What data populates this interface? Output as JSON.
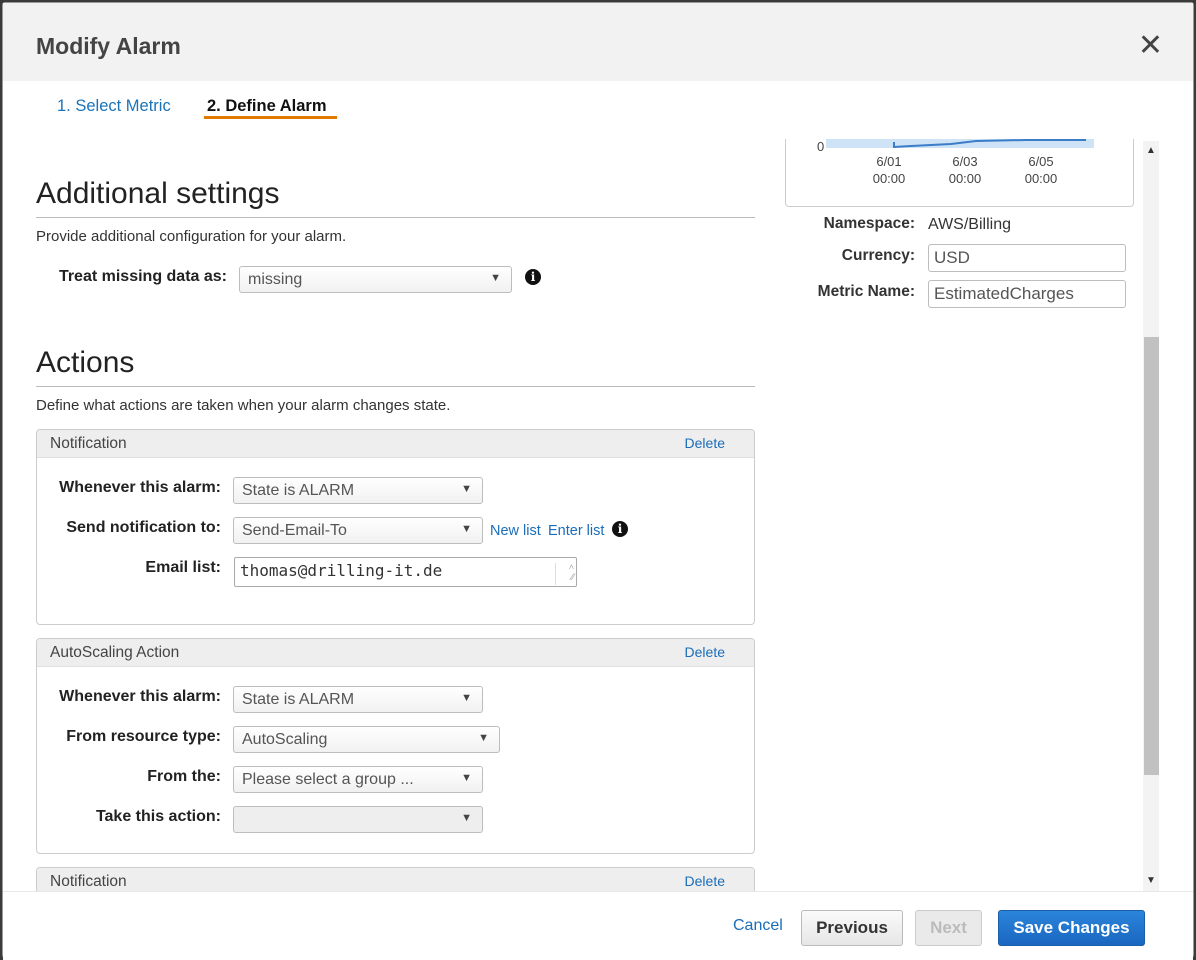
{
  "modal": {
    "title": "Modify Alarm"
  },
  "tabs": [
    {
      "label": "1. Select Metric"
    },
    {
      "label": "2. Define Alarm"
    }
  ],
  "chart": {
    "y_tick": "0",
    "x_ticks": [
      {
        "date": "6/01",
        "time": "00:00"
      },
      {
        "date": "6/03",
        "time": "00:00"
      },
      {
        "date": "6/05",
        "time": "00:00"
      }
    ]
  },
  "metric_info": {
    "namespace_label": "Namespace:",
    "namespace_value": "AWS/Billing",
    "currency_label": "Currency:",
    "currency_value": "USD",
    "metric_name_label": "Metric Name:",
    "metric_name_value": "EstimatedCharges"
  },
  "additional_settings": {
    "heading": "Additional settings",
    "description": "Provide additional configuration for your alarm.",
    "treat_missing_label": "Treat missing data as:",
    "treat_missing_value": "missing"
  },
  "actions": {
    "heading": "Actions",
    "description": "Define what actions are taken when your alarm changes state."
  },
  "notification_panel": {
    "title": "Notification",
    "delete_label": "Delete",
    "whenever_label": "Whenever this alarm:",
    "whenever_value": "State is ALARM",
    "send_label": "Send notification to:",
    "send_value": "Send-Email-To",
    "new_list": "New list",
    "enter_list": "Enter list",
    "email_label": "Email list:",
    "email_value": "thomas@drilling-it.de"
  },
  "autoscaling_panel": {
    "title": "AutoScaling Action",
    "delete_label": "Delete",
    "whenever_label": "Whenever this alarm:",
    "whenever_value": "State is ALARM",
    "resource_label": "From resource type:",
    "resource_value": "AutoScaling",
    "from_label": "From the:",
    "from_value": "Please select a group ...",
    "action_label": "Take this action:",
    "action_value": ""
  },
  "notification_panel_2": {
    "title": "Notification",
    "delete_label": "Delete"
  },
  "footer": {
    "cancel": "Cancel",
    "previous": "Previous",
    "next": "Next",
    "save": "Save Changes"
  }
}
